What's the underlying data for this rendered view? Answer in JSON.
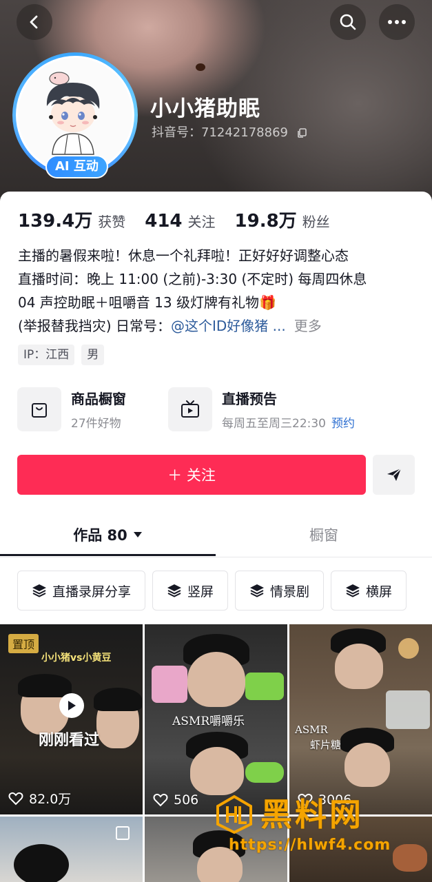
{
  "header": {
    "nickname": "小小猪助眠",
    "douyin_id": "抖音号：71242178869",
    "ai_badge": "AI 互动"
  },
  "stats": [
    {
      "value": "139.4万",
      "label": "获赞"
    },
    {
      "value": "414",
      "label": "关注"
    },
    {
      "value": "19.8万",
      "label": "粉丝"
    }
  ],
  "bio": {
    "line1": "主播的暑假来啦！休息一个礼拜啦！正好好好调整心态",
    "line2": "直播时间：晚上 11:00 (之前)-3:30 (不定时) 每周四休息",
    "line3": "04 声控助眠＋咀嚼音 13 级灯牌有礼物🎁",
    "line4_prefix": "(举报替我挡灾) 日常号：",
    "line4_link": "@这个ID好像猪 ...",
    "more": "更多"
  },
  "tags": [
    "IP：江西",
    "男"
  ],
  "entries": {
    "shop": {
      "title": "商品橱窗",
      "sub": "27件好物"
    },
    "live": {
      "title": "直播预告",
      "sub": "每周五至周三22:30",
      "action": "预约"
    }
  },
  "follow_label": "＋ 关注",
  "tabs": {
    "works": "作品 80",
    "shop": "橱窗"
  },
  "chips": [
    "直播录屏分享",
    "竖屏",
    "情景剧",
    "横屏"
  ],
  "grid": [
    {
      "pinned": "置顶",
      "cover_title": "小小猪vs小黄豆",
      "watched": "刚刚看过",
      "likes": "82.0万"
    },
    {
      "overlay": "ASMR嚼嚼乐",
      "likes": "506"
    },
    {
      "overlay_line1": "ASMR",
      "overlay_line2": "虾片糖",
      "likes": "3006"
    }
  ],
  "watermark": {
    "title": "黑料网",
    "url": "https://hlwf4.com"
  },
  "colors": {
    "follow": "#fe2c55",
    "link": "#2d5b9b",
    "ai_badge": "#2f8dff",
    "watermark": "#f5a400"
  },
  "icons": [
    "back-icon",
    "search-icon",
    "more-icon",
    "copy-icon",
    "shop-bag-icon",
    "tv-icon",
    "send-icon",
    "caret-down-icon",
    "layers-icon",
    "play-icon",
    "heart-icon"
  ]
}
